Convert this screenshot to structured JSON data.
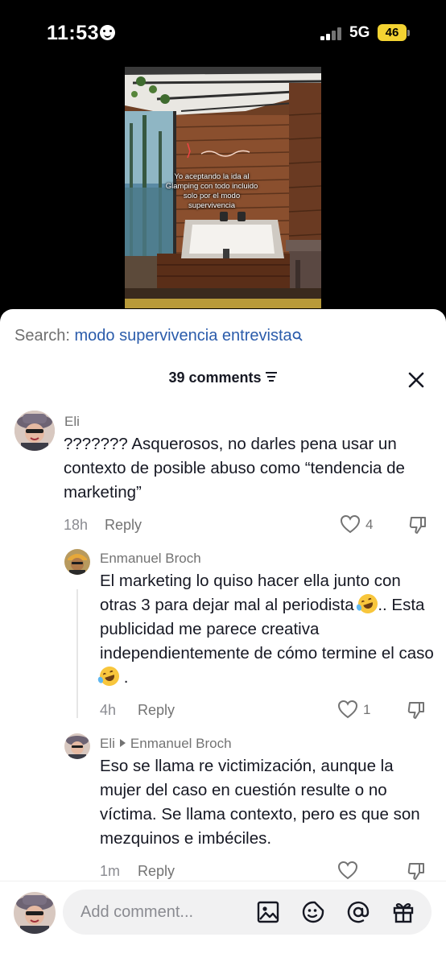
{
  "status": {
    "time": "11:53",
    "network": "5G",
    "battery": "46"
  },
  "video": {
    "caption": "Yo aceptando la ida al Glamping con todo incluido solo por el modo supervivencia"
  },
  "search": {
    "label": "Search:",
    "query": "modo supervivencia entrevista"
  },
  "comments_header": {
    "count_label": "39 comments"
  },
  "comments": [
    {
      "username": "Eli",
      "text": "??????? Asquerosos, no darles pena usar un contexto de posible abuso como “tendencia de marketing”",
      "time": "18h",
      "reply_label": "Reply",
      "likes": "4"
    },
    {
      "username": "Enmanuel Broch",
      "text_part1": "El marketing lo quiso hacer ella junto con otras 3 para dejar mal al periodista",
      "text_part2": ".. Esta publicidad me parece creativa independientemente de cómo termine el caso",
      "text_part3": " .",
      "emoji": "rolling-on-floor-laughing-emoji",
      "time": "4h",
      "reply_label": "Reply",
      "likes": "1"
    },
    {
      "username": "Eli",
      "reply_to": "Enmanuel Broch",
      "text": "Eso se llama re victimización, aunque la mujer del caso en cuestión resulte o no víctima. Se llama contexto, pero es que son mezquinos e imbéciles.",
      "time": "1m",
      "reply_label": "Reply"
    }
  ],
  "composer": {
    "placeholder": "Add comment..."
  },
  "colors": {
    "accent_link": "#2b5cab",
    "battery": "#f3d332",
    "text": "#161823",
    "muted": "#8a8b91"
  },
  "icons": [
    "search-icon",
    "sort-icon",
    "close-icon",
    "heart-icon",
    "dislike-icon",
    "image-icon",
    "emoji-icon",
    "mention-icon",
    "gift-icon"
  ]
}
